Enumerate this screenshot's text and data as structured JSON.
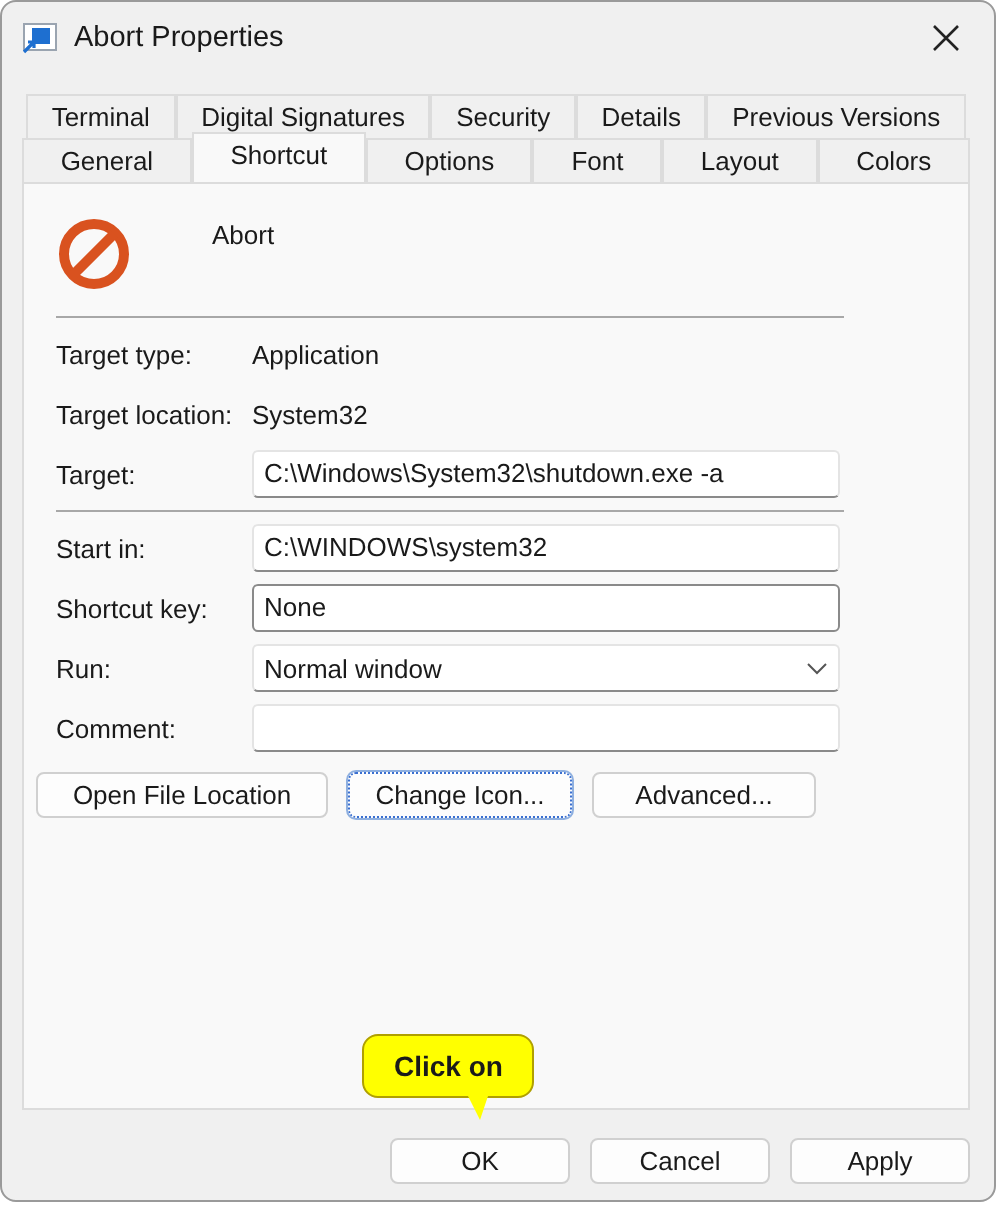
{
  "window": {
    "title": "Abort Properties"
  },
  "tab_rows": [
    [
      {
        "label": "Terminal",
        "selected": false
      },
      {
        "label": "Digital Signatures",
        "selected": false
      },
      {
        "label": "Security",
        "selected": false
      },
      {
        "label": "Details",
        "selected": false
      },
      {
        "label": "Previous Versions",
        "selected": false
      }
    ],
    [
      {
        "label": "General",
        "selected": false
      },
      {
        "label": "Shortcut",
        "selected": true
      },
      {
        "label": "Options",
        "selected": false
      },
      {
        "label": "Font",
        "selected": false
      },
      {
        "label": "Layout",
        "selected": false
      },
      {
        "label": "Colors",
        "selected": false
      }
    ]
  ],
  "shortcut_name": "Abort",
  "sections": [
    {
      "rows": [
        {
          "kind": "info",
          "label": "Target type:",
          "value": "Application"
        },
        {
          "kind": "info",
          "label": "Target location:",
          "value": "System32"
        },
        {
          "kind": "field",
          "label": "Target:",
          "value": "C:\\Windows\\System32\\shutdown.exe -a"
        }
      ]
    },
    {
      "rows": [
        {
          "kind": "field",
          "label": "Start in:",
          "value": "C:\\WINDOWS\\system32"
        },
        {
          "kind": "boxed",
          "label": "Shortcut key:",
          "value": "None"
        },
        {
          "kind": "dropdown",
          "label": "Run:",
          "value": "Normal window"
        },
        {
          "kind": "field",
          "label": "Comment:"
        }
      ]
    }
  ],
  "actions": [
    {
      "label": "Open File Location",
      "focused": false
    },
    {
      "label": "Change Icon...",
      "focused": true
    },
    {
      "label": "Advanced...",
      "focused": false
    }
  ],
  "buttons": [
    "OK",
    "Cancel",
    "Apply"
  ],
  "callout": {
    "text": "Click on"
  }
}
